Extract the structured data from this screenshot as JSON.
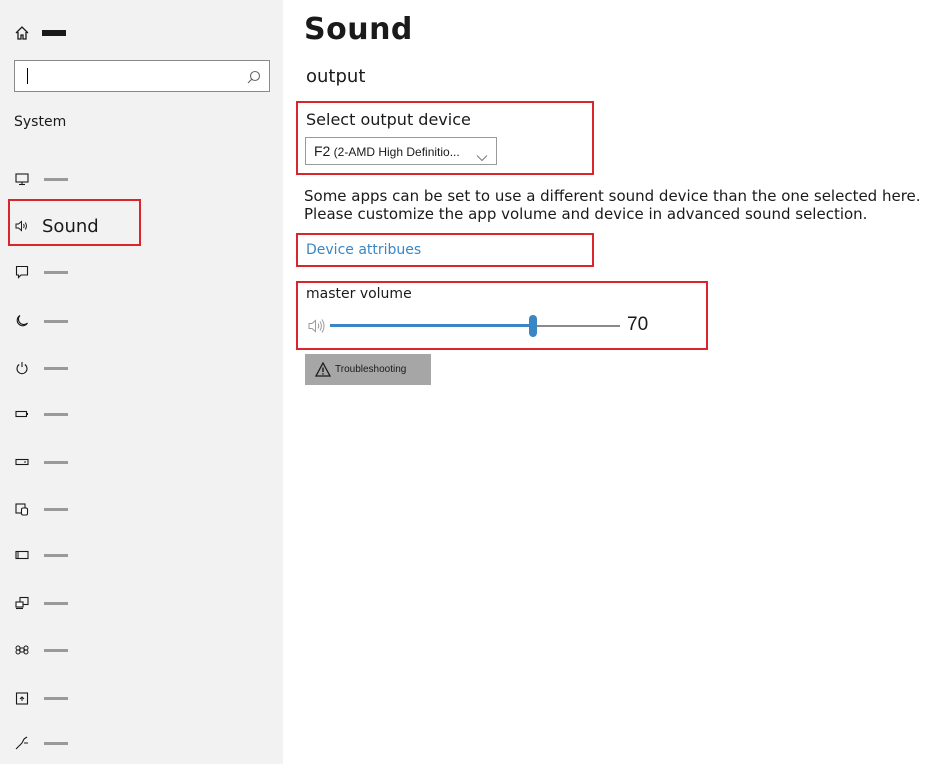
{
  "sidebar": {
    "search": {
      "value": "",
      "placeholder": ""
    },
    "heading": "System",
    "items": [
      {
        "icon": "display-icon",
        "label": ""
      },
      {
        "icon": "speaker-icon",
        "label": "Sound",
        "selected": true
      },
      {
        "icon": "notification-icon",
        "label": ""
      },
      {
        "icon": "moon-icon",
        "label": ""
      },
      {
        "icon": "power-icon",
        "label": ""
      },
      {
        "icon": "battery-icon",
        "label": ""
      },
      {
        "icon": "storage-icon",
        "label": ""
      },
      {
        "icon": "tablet-icon",
        "label": ""
      },
      {
        "icon": "multitasking-icon",
        "label": ""
      },
      {
        "icon": "projecting-icon",
        "label": ""
      },
      {
        "icon": "shared-experiences-icon",
        "label": ""
      },
      {
        "icon": "clipboard-icon",
        "label": ""
      },
      {
        "icon": "remote-desktop-icon",
        "label": ""
      }
    ]
  },
  "main": {
    "title": "Sound",
    "section": "output",
    "output_device": {
      "label": "Select output device",
      "selected_prefix": "F2",
      "selected_rest": " (2-AMD High Definitio..."
    },
    "description": [
      "Some apps can be set to use a different sound device than the one selected here.",
      "Please customize the app volume and device in advanced sound selection."
    ],
    "device_link": "Device attribues",
    "volume": {
      "label": "master volume",
      "value": 70,
      "value_text": "70"
    },
    "troubleshoot_label": "Troubleshooting"
  },
  "colors": {
    "accent": "#3a86c4",
    "highlight": "#d9252b",
    "sidebar_bg": "#f2f2f2"
  }
}
